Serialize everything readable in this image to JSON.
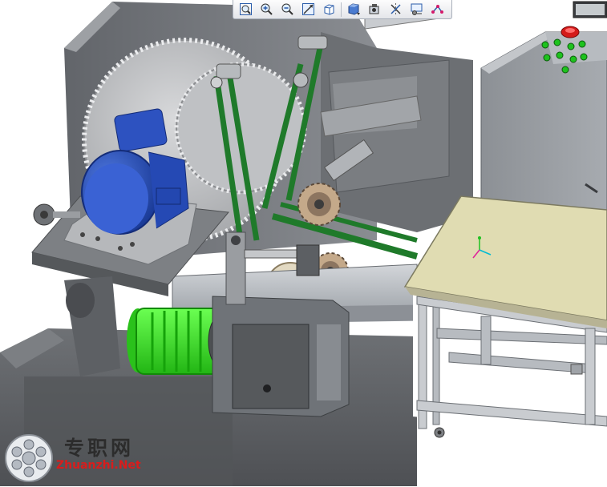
{
  "toolbar": {
    "buttons": [
      {
        "name": "zoom-fit",
        "icon": "zoom-to-fit-icon"
      },
      {
        "name": "zoom-in",
        "icon": "zoom-in-icon"
      },
      {
        "name": "zoom-out",
        "icon": "zoom-out-icon"
      },
      {
        "name": "previous-view",
        "icon": "previous-view-icon"
      },
      {
        "name": "view-orientation",
        "icon": "view-cube-icon"
      },
      {
        "name": "display-style",
        "icon": "display-style-icon"
      },
      {
        "name": "hide-show-items",
        "icon": "hide-show-icon"
      },
      {
        "name": "section-view",
        "icon": "section-view-icon"
      },
      {
        "name": "view-settings",
        "icon": "view-settings-icon"
      },
      {
        "name": "apply-scene",
        "icon": "apply-scene-icon"
      }
    ]
  },
  "colors": {
    "motor_blue": "#2347b0",
    "motor_green": "#2ee01a",
    "belt_green": "#1f7a2a",
    "frame_gray": "#7b7e82",
    "panel_gray": "#9a9ea3",
    "table_tan": "#e0dcb2",
    "stop_button_red": "#d41a1a",
    "button_green": "#1ec21e"
  },
  "watermark": {
    "chinese": "专职网",
    "english": "Zhuanzhi.Net"
  }
}
